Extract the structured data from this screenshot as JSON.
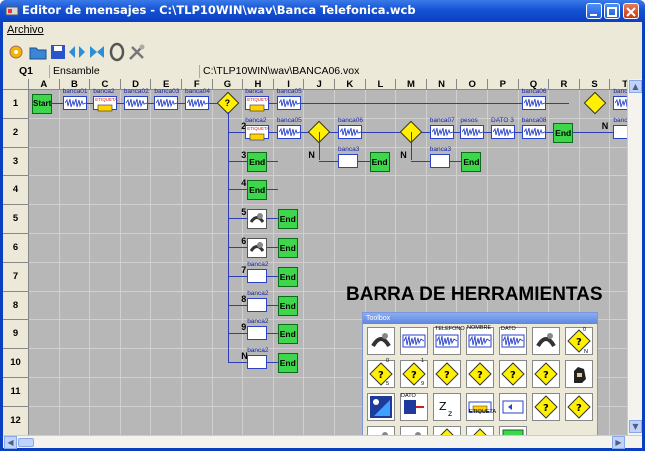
{
  "window": {
    "title": "Editor de mensajes - C:\\TLP10WIN\\wav\\Banca Telefonica.wcb"
  },
  "menu": {
    "archivo": "Archivo"
  },
  "toolbar": {
    "icons": [
      "open-icon",
      "folder-icon",
      "save-icon",
      "play-icon",
      "stop-icon",
      "zero-icon",
      "tools-icon"
    ]
  },
  "cellbar": {
    "cell": "Q1",
    "name": "Ensamble",
    "path": "C:\\TLP10WIN\\wav\\BANCA06.vox"
  },
  "grid": {
    "columns": [
      "A",
      "B",
      "C",
      "D",
      "E",
      "F",
      "G",
      "H",
      "I",
      "J",
      "K",
      "L",
      "M",
      "N",
      "O",
      "P",
      "Q",
      "R",
      "S",
      "T"
    ],
    "rows": [
      "1",
      "2",
      "3",
      "4",
      "5",
      "6",
      "7",
      "8",
      "9",
      "10",
      "11",
      "12"
    ],
    "row1": {
      "start": "Start",
      "labels": [
        "banca01",
        "banca2",
        "banca02",
        "banca03",
        "banca04",
        "banca",
        "banca05",
        "banca06",
        "banca07"
      ],
      "etiqueta": "ETIQUETA",
      "question": "?",
      "etiq2": "ETIQUETA"
    },
    "row2": {
      "num": "2",
      "labels": [
        "banca2",
        "banca05",
        "banca06",
        "banca07",
        "pesos",
        "DATO 3",
        "banca08",
        "banca"
      ],
      "etiqueta": "ETIQUETA",
      "end": "End",
      "n": "N"
    },
    "branches": [
      {
        "num": "3",
        "end": "End"
      },
      {
        "num": "4",
        "end": "End"
      },
      {
        "num": "5",
        "end": "End"
      },
      {
        "num": "6",
        "end": "End"
      },
      {
        "num": "7",
        "label": "banca2",
        "end": "End"
      },
      {
        "num": "8",
        "label": "banca2",
        "end": "End"
      },
      {
        "num": "9",
        "label": "banca2",
        "end": "End"
      },
      {
        "num": "N",
        "label": "banca2",
        "end": "End"
      }
    ],
    "row3": {
      "n1": "N",
      "label1": "banca3",
      "end1": "End",
      "n2": "N",
      "label2": "banca3",
      "end2": "End"
    }
  },
  "annotation": "BARRA DE HERRAMIENTAS",
  "toolbox": {
    "title": "Toolbox",
    "labels": {
      "telefono": "TELEFONO",
      "nombre": "NOMBRE",
      "dato": "DATO",
      "dato2": "DATO",
      "etiqueta": "ETIQUETA",
      "end": "End"
    },
    "digits": {
      "zero": "0",
      "n": "N",
      "five": "5",
      "one": "1",
      "nine": "9"
    },
    "tools": [
      "phone-dial-icon",
      "wave-icon",
      "wave-telefono-icon",
      "wave-nombre-icon",
      "wave-dato-icon",
      "phone-door-icon",
      "question-zero-n-icon",
      "question-zero-five-icon",
      "question-one-nine-icon",
      "eye-arrow-icon",
      "record-icon",
      "compare-icon",
      "question-arrows-icon",
      "hand-icon",
      "night-icon",
      "dato-arrow-icon",
      "sleep-icon",
      "etiqueta-icon",
      "ir-icon",
      "ir-compare-icon",
      "help-icon",
      "phone-hangup-icon",
      "phone-grid-icon",
      "sound-diamond-icon",
      "edit-diamond-icon",
      "end-icon"
    ]
  },
  "colors": {
    "titlebar": "#0b40bf",
    "grid_bg": "#b7b7b7",
    "wire": "#2e3db3",
    "start_end": "#3ed64a",
    "decision": "#ffef00"
  }
}
